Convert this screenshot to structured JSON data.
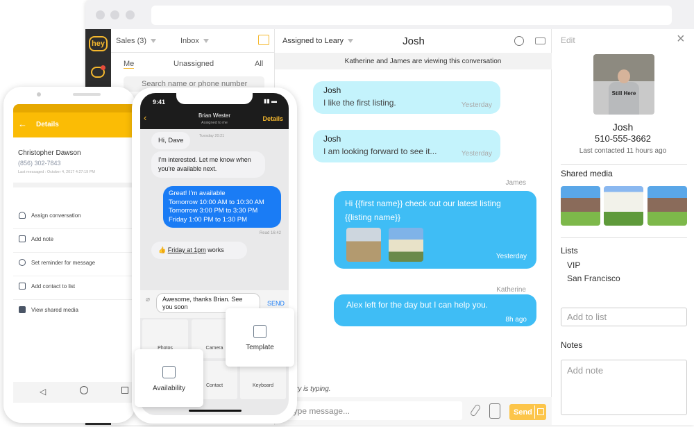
{
  "colors": {
    "accent": "#fbbc05",
    "bubble_in": "#c4f3fc",
    "bubble_out": "#3fbdf5",
    "ios_blue": "#1a7cf5",
    "send": "#fcc54a"
  },
  "web": {
    "logo": "hey",
    "list": {
      "account": "Sales (3)",
      "folder": "Inbox",
      "tabs": [
        "Me",
        "Unassigned",
        "All"
      ],
      "search_placeholder": "Search name or phone number"
    },
    "conversation": {
      "assigned": "Assigned to Leary",
      "title": "Josh",
      "viewing_banner": "Katherine and James are viewing this conversation",
      "messages": [
        {
          "sender": "Josh",
          "text": "I like the first listing.",
          "time": "Yesterday"
        },
        {
          "sender": "Josh",
          "text": "I am looking forward to see it...",
          "time": "Yesterday"
        },
        {
          "sender": "James",
          "text": "Hi {{first name}} check out our latest listing {{listing name}}",
          "time": "Yesterday"
        },
        {
          "sender": "Katherine",
          "text": "Alex left for the day but I can help you.",
          "time": "8h ago"
        }
      ],
      "typing": "ry is typing.",
      "input_placeholder": "Type message...",
      "send_label": "Send"
    },
    "contact": {
      "edit": "Edit",
      "name": "Josh",
      "phone": "510-555-3662",
      "last_contacted": "Last contacted 11 hours ago",
      "shirt_text": "Still Here",
      "shared_media_title": "Shared media",
      "lists_title": "Lists",
      "lists": [
        "VIP",
        "San Francisco"
      ],
      "add_list_placeholder": "Add to list",
      "notes_title": "Notes",
      "add_note_placeholder": "Add note"
    }
  },
  "android": {
    "title": "Details",
    "name": "Christopher Dawson",
    "phone": "(856) 302-7843",
    "last": "Last messaged : October 4, 2017 4:27:19 PM",
    "items": [
      "Assign conversation",
      "Add note",
      "Set reminder for message",
      "Add contact to list",
      "View shared media"
    ]
  },
  "ios": {
    "time": "9:41",
    "contact": "Brian Wester",
    "sub": "Assigned to me",
    "details": "Details",
    "timestamp": "Tuesday 20:21",
    "msgs": [
      "Hi, Dave",
      "I'm interested. Let me know when you're available next."
    ],
    "out": [
      "Great! I'm available",
      "Tomorrow 10:00 AM to 10:30 AM",
      "Tomorrow 3:00 PM to 3:30 PM",
      "Friday 1:00 PM to 1:30 PM"
    ],
    "read": "Read 16:42",
    "reply_link": "Friday at 1pm",
    "reply_rest": " works",
    "draft": "Awesome, thanks Brian. See you soon",
    "send": "SEND",
    "tiles": [
      "Photos",
      "Camera",
      "Contact",
      "Keyboard"
    ],
    "template": "Template",
    "availability": "Availability"
  }
}
